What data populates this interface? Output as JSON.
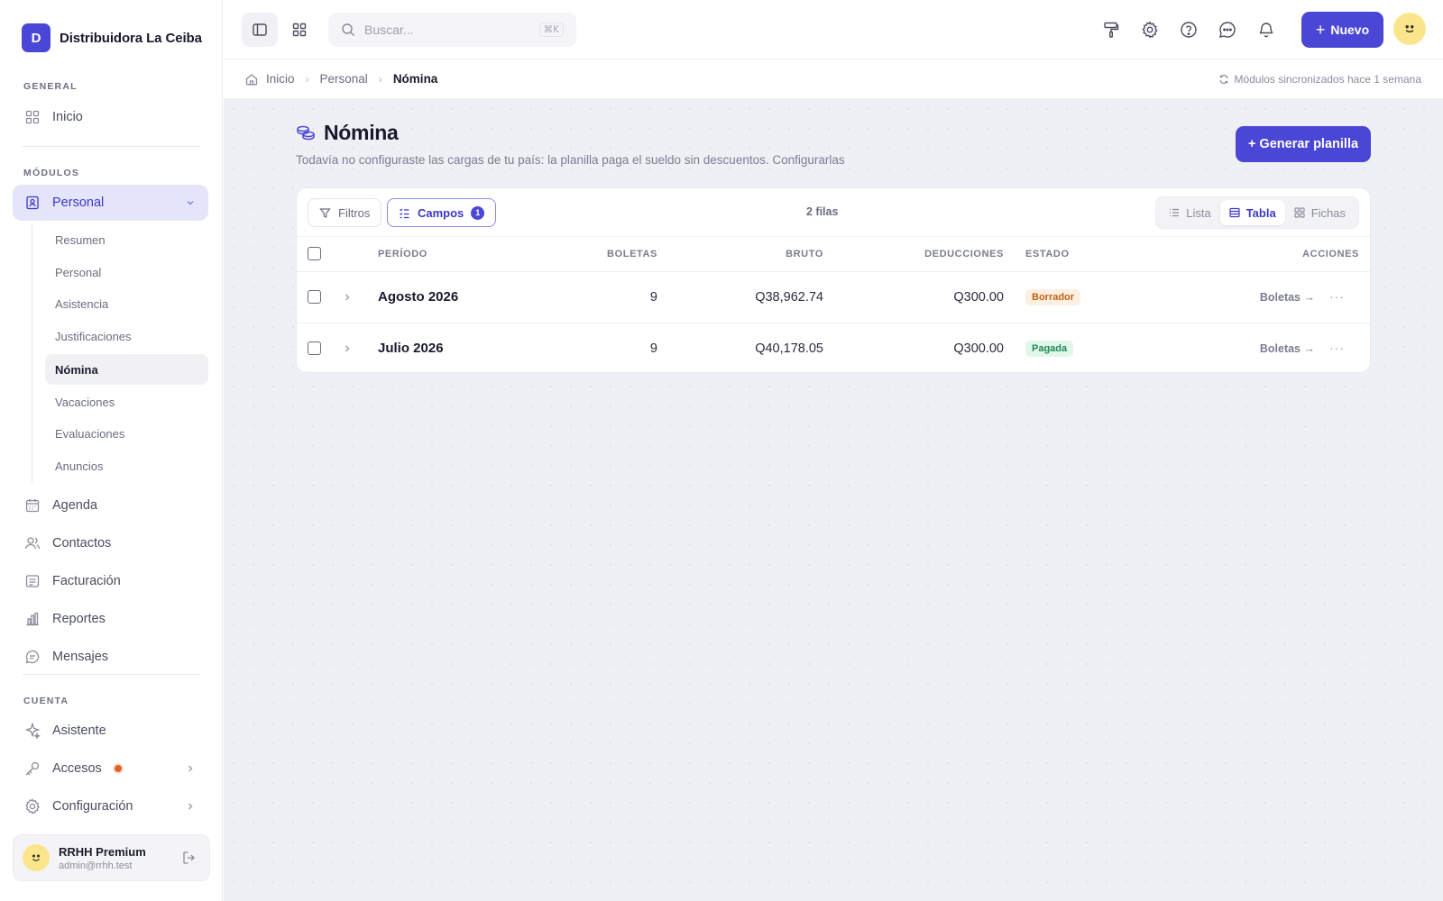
{
  "brand": {
    "logo_letter": "D",
    "name": "Distribuidora La Ceiba",
    "accent": "#4b47d6"
  },
  "sidebar": {
    "general_title": "GENERAL",
    "inicio": "Inicio",
    "modules_title": "MÓDULOS",
    "personal": "Personal",
    "personal_sub": [
      "Resumen",
      "Personal",
      "Asistencia",
      "Justificaciones",
      "Nómina",
      "Vacaciones",
      "Evaluaciones",
      "Anuncios"
    ],
    "modules": [
      "Agenda",
      "Contactos",
      "Facturación",
      "Reportes",
      "Mensajes"
    ],
    "account_title": "CUENTA",
    "account": [
      "Asistente",
      "Accesos",
      "Configuración"
    ]
  },
  "user": {
    "name": "RRHH Premium",
    "email": "admin@rrhh.test"
  },
  "topbar": {
    "search_placeholder": "Buscar...",
    "search_shortcut": "⌘K",
    "new_label": "Nuevo"
  },
  "breadcrumb": {
    "home": "Inicio",
    "section": "Personal",
    "current": "Nómina"
  },
  "sync_status": "Módulos sincronizados hace 1 semana",
  "page": {
    "title": "Nómina",
    "subtitle": "Todavía no configuraste las cargas de tu país: la planilla paga el sueldo sin descuentos.",
    "configure_link": "Configurarlas",
    "generate_button": "+ Generar planilla"
  },
  "toolbar": {
    "filters": "Filtros",
    "fields": "Campos",
    "fields_count": "1",
    "rows_count": "2 filas",
    "views": [
      "Lista",
      "Tabla",
      "Fichas"
    ],
    "active_view": "Tabla"
  },
  "table": {
    "headers": {
      "period": "PERÍODO",
      "slips": "BOLETAS",
      "gross": "BRUTO",
      "deductions": "DEDUCCIONES",
      "status": "ESTADO",
      "actions": "ACCIONES"
    },
    "rows": [
      {
        "period": "Agosto 2026",
        "slips": "9",
        "gross": "Q38,962.74",
        "deductions": "Q300.00",
        "status": "Borrador",
        "action": "Boletas →"
      },
      {
        "period": "Julio 2026",
        "slips": "9",
        "gross": "Q40,178.05",
        "deductions": "Q300.00",
        "status": "Pagada",
        "action": "Boletas →"
      }
    ]
  },
  "status_colors": {
    "Borrador": "#c2620f",
    "Pagada": "#1d8a55"
  }
}
